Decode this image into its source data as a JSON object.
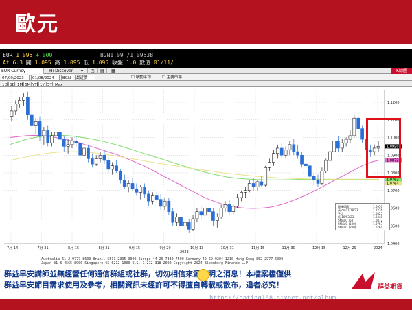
{
  "title": "歐元",
  "quote": {
    "ticker": "EUR",
    "last": "1.095",
    "change": "+.000",
    "bgn": "BGN1.09 /1.0953B",
    "line2_prefix": "At",
    "time": "6:3",
    "open_label": "開",
    "open": "1.095",
    "high_label": "高",
    "high": "1.095",
    "low_label": "低",
    "low": "1.095",
    "close_label": "收盤",
    "close": "1.0",
    "vol_label": "數值",
    "date": "01/11/"
  },
  "toolbar": {
    "security": "EUR Curncy",
    "discover": "Hi Discover",
    "right_btn": "K線圖"
  },
  "options": {
    "date_from": "07/09/2023",
    "date_to": "01/08/2024",
    "source": "BGN",
    "period_label": "最近價",
    "chk1": "移動平均",
    "chk2": "主要市場"
  },
  "chart_data": {
    "type": "candlestick",
    "yaxis_ticks": [
      "1.1200",
      "1.1100",
      "1.1000",
      "1.0900",
      "1.0800",
      "1.0700",
      "1.0600",
      "1.0500",
      "1.0400"
    ],
    "ylim": [
      1.04,
      1.127
    ],
    "xaxis_ticks": [
      "7月 14",
      "7月 31",
      "8月 15",
      "8月 31",
      "9月 15",
      "9月 29",
      "10月 13",
      "10月 31",
      "11月 15",
      "11月 30",
      "12月 15",
      "12月 29",
      "2024"
    ],
    "year_label": "2023",
    "last_price": "1.0950",
    "ma_labels": [
      "1.0872",
      "1.0763",
      "1.0764"
    ],
    "candles": [
      [
        1.112,
        1.118,
        1.109,
        1.115
      ],
      [
        1.115,
        1.121,
        1.113,
        1.119
      ],
      [
        1.119,
        1.123,
        1.117,
        1.121
      ],
      [
        1.121,
        1.125,
        1.118,
        1.123
      ],
      [
        1.123,
        1.126,
        1.11,
        1.113
      ],
      [
        1.113,
        1.116,
        1.105,
        1.107
      ],
      [
        1.107,
        1.111,
        1.102,
        1.109
      ],
      [
        1.109,
        1.112,
        1.098,
        1.101
      ],
      [
        1.101,
        1.106,
        1.096,
        1.104
      ],
      [
        1.104,
        1.107,
        1.095,
        1.097
      ],
      [
        1.097,
        1.103,
        1.095,
        1.101
      ],
      [
        1.101,
        1.106,
        1.098,
        1.103
      ],
      [
        1.103,
        1.104,
        1.096,
        1.099
      ],
      [
        1.099,
        1.101,
        1.092,
        1.095
      ],
      [
        1.095,
        1.099,
        1.091,
        1.096
      ],
      [
        1.096,
        1.1,
        1.094,
        1.098
      ],
      [
        1.098,
        1.101,
        1.095,
        1.097
      ],
      [
        1.097,
        1.098,
        1.088,
        1.09
      ],
      [
        1.09,
        1.096,
        1.088,
        1.094
      ],
      [
        1.094,
        1.096,
        1.086,
        1.088
      ],
      [
        1.088,
        1.091,
        1.083,
        1.085
      ],
      [
        1.085,
        1.09,
        1.084,
        1.088
      ],
      [
        1.088,
        1.092,
        1.086,
        1.09
      ],
      [
        1.09,
        1.093,
        1.085,
        1.087
      ],
      [
        1.087,
        1.089,
        1.08,
        1.082
      ],
      [
        1.082,
        1.086,
        1.079,
        1.084
      ],
      [
        1.084,
        1.087,
        1.08,
        1.081
      ],
      [
        1.081,
        1.082,
        1.074,
        1.076
      ],
      [
        1.076,
        1.079,
        1.071,
        1.072
      ],
      [
        1.072,
        1.076,
        1.069,
        1.074
      ],
      [
        1.074,
        1.077,
        1.07,
        1.071
      ],
      [
        1.071,
        1.074,
        1.067,
        1.069
      ],
      [
        1.069,
        1.073,
        1.065,
        1.072
      ],
      [
        1.072,
        1.074,
        1.066,
        1.068
      ],
      [
        1.068,
        1.07,
        1.061,
        1.064
      ],
      [
        1.064,
        1.069,
        1.062,
        1.067
      ],
      [
        1.067,
        1.07,
        1.063,
        1.065
      ],
      [
        1.065,
        1.068,
        1.059,
        1.061
      ],
      [
        1.061,
        1.066,
        1.059,
        1.064
      ],
      [
        1.064,
        1.066,
        1.056,
        1.058
      ],
      [
        1.058,
        1.06,
        1.05,
        1.052
      ],
      [
        1.052,
        1.057,
        1.05,
        1.055
      ],
      [
        1.055,
        1.058,
        1.048,
        1.05
      ],
      [
        1.05,
        1.054,
        1.047,
        1.052
      ],
      [
        1.052,
        1.054,
        1.046,
        1.048
      ],
      [
        1.048,
        1.056,
        1.047,
        1.054
      ],
      [
        1.054,
        1.06,
        1.052,
        1.058
      ],
      [
        1.058,
        1.061,
        1.053,
        1.056
      ],
      [
        1.056,
        1.062,
        1.054,
        1.06
      ],
      [
        1.06,
        1.063,
        1.056,
        1.058
      ],
      [
        1.058,
        1.06,
        1.05,
        1.053
      ],
      [
        1.053,
        1.057,
        1.049,
        1.055
      ],
      [
        1.055,
        1.062,
        1.054,
        1.06
      ],
      [
        1.06,
        1.064,
        1.058,
        1.062
      ],
      [
        1.062,
        1.065,
        1.056,
        1.058
      ],
      [
        1.058,
        1.062,
        1.056,
        1.061
      ],
      [
        1.061,
        1.068,
        1.06,
        1.066
      ],
      [
        1.066,
        1.07,
        1.064,
        1.069
      ],
      [
        1.069,
        1.072,
        1.066,
        1.07
      ],
      [
        1.07,
        1.076,
        1.069,
        1.074
      ],
      [
        1.074,
        1.077,
        1.07,
        1.072
      ],
      [
        1.072,
        1.076,
        1.07,
        1.075
      ],
      [
        1.075,
        1.078,
        1.072,
        1.073
      ],
      [
        1.073,
        1.084,
        1.072,
        1.083
      ],
      [
        1.083,
        1.088,
        1.081,
        1.086
      ],
      [
        1.086,
        1.093,
        1.084,
        1.091
      ],
      [
        1.091,
        1.096,
        1.088,
        1.094
      ],
      [
        1.094,
        1.097,
        1.088,
        1.09
      ],
      [
        1.09,
        1.095,
        1.088,
        1.093
      ],
      [
        1.093,
        1.098,
        1.09,
        1.096
      ],
      [
        1.096,
        1.099,
        1.09,
        1.092
      ],
      [
        1.092,
        1.096,
        1.088,
        1.09
      ],
      [
        1.09,
        1.092,
        1.083,
        1.085
      ],
      [
        1.085,
        1.088,
        1.082,
        1.084
      ],
      [
        1.084,
        1.086,
        1.076,
        1.078
      ],
      [
        1.078,
        1.08,
        1.073,
        1.076
      ],
      [
        1.076,
        1.079,
        1.072,
        1.074
      ],
      [
        1.074,
        1.083,
        1.073,
        1.081
      ],
      [
        1.081,
        1.088,
        1.08,
        1.087
      ],
      [
        1.087,
        1.093,
        1.086,
        1.092
      ],
      [
        1.092,
        1.099,
        1.09,
        1.098
      ],
      [
        1.098,
        1.101,
        1.092,
        1.094
      ],
      [
        1.094,
        1.099,
        1.092,
        1.097
      ],
      [
        1.097,
        1.1,
        1.095,
        1.099
      ],
      [
        1.099,
        1.104,
        1.097,
        1.101
      ],
      [
        1.101,
        1.113,
        1.1,
        1.111
      ],
      [
        1.111,
        1.114,
        1.103,
        1.105
      ],
      [
        1.105,
        1.107,
        1.097,
        1.099
      ],
      [
        1.099,
        1.101,
        1.091,
        1.093
      ],
      [
        1.093,
        1.096,
        1.089,
        1.092
      ],
      [
        1.092,
        1.096,
        1.09,
        1.094
      ],
      [
        1.094,
        1.098,
        1.092,
        1.095
      ]
    ],
    "ma_series": [
      {
        "name": "SMAVG (50)",
        "color": "#e066c8",
        "values": [
          1.1,
          1.1005,
          1.101,
          1.1012,
          1.101,
          1.1005,
          1.0995,
          1.0985,
          1.0975,
          1.096,
          1.0945,
          1.093,
          1.0915,
          1.09,
          1.088,
          1.086,
          1.084,
          1.0815,
          1.079,
          1.0765,
          1.074,
          1.0715,
          1.069,
          1.0665,
          1.0645,
          1.0628,
          1.0615,
          1.0605,
          1.06,
          1.0598,
          1.06,
          1.0605,
          1.0615,
          1.063,
          1.0648,
          1.0668,
          1.069,
          1.0715,
          1.074,
          1.0765,
          1.079,
          1.0815,
          1.084,
          1.086,
          1.0872
        ]
      },
      {
        "name": "SMAVG (100)",
        "color": "#7ddc6a",
        "values": [
          1.096,
          1.0975,
          1.099,
          1.1,
          1.1008,
          1.1012,
          1.1012,
          1.101,
          1.1005,
          1.0998,
          1.099,
          1.098,
          1.0968,
          1.0955,
          1.094,
          1.0925,
          1.091,
          1.0895,
          1.088,
          1.0865,
          1.085,
          1.0835,
          1.082,
          1.0807,
          1.0795,
          1.0785,
          1.0776,
          1.077,
          1.0766,
          1.0763,
          1.0761,
          1.076,
          1.076,
          1.0761,
          1.0762,
          1.0763,
          1.0763,
          1.0763,
          1.0763,
          1.0763,
          1.0763,
          1.0763,
          1.0763,
          1.0763,
          1.0763
        ]
      },
      {
        "name": "SMAVG (200)",
        "color": "#e9e38a",
        "values": [
          1.087,
          1.088,
          1.089,
          1.09,
          1.0908,
          1.0914,
          1.0918,
          1.092,
          1.092,
          1.0918,
          1.0914,
          1.0908,
          1.09,
          1.0892,
          1.0884,
          1.0876,
          1.0868,
          1.086,
          1.0852,
          1.0845,
          1.0838,
          1.083,
          1.0823,
          1.0816,
          1.081,
          1.0803,
          1.0797,
          1.0792,
          1.0787,
          1.0782,
          1.0778,
          1.0775,
          1.0772,
          1.077,
          1.0768,
          1.0766,
          1.0765,
          1.0764,
          1.0764,
          1.0764,
          1.0764,
          1.0764,
          1.0764,
          1.0764,
          1.0764
        ]
      }
    ]
  },
  "legend": {
    "rows": [
      {
        "label": "最後價格",
        "value": "1.0950"
      },
      {
        "label": "高 on 07/18/23",
        "value": "1.1276"
      },
      {
        "label": "平均",
        "value": "1.0825"
      },
      {
        "label": "低 10/03/23",
        "value": "1.0448"
      },
      {
        "label": "SMAVG (50)",
        "value": "1.0872"
      },
      {
        "label": "SMAVG (100)",
        "value": "1.0763"
      },
      {
        "label": "SMAVG (200)",
        "value": "1.0764"
      }
    ]
  },
  "footer": {
    "line1": "Australia 61 2 9777 8600 Brazil 5511 2395 9000 Europe 44 20 7330 7500 Germany 49 69 9204 1210 Hong Kong 852 2977 6000",
    "line2": "Japan 81 3 4565 8900        Singapore 65 6212 1000       U.S. 1 212 318 2000        Copyright 2024 Bloomberg Finance L.P.",
    "line3": "SN 126661 HKT GMT+8:00 G652-2145-171 09-Jan-2024 06:34:30"
  },
  "disclaimer": {
    "line1": "群益早安講師並無經營任何通信群組或社群，切勿相信來源不明之消息！本檔案檔僅供",
    "line2": "群益早安節目需求使用及參考，相關資訊未經許可不得擅自轉載或散布，違者必究！"
  },
  "watermark": {
    "text": "群 益 期 貨       宜 庭 EATING",
    "url": "https://eating168.pixnet.net/album"
  },
  "brand": {
    "name": "群益期貨",
    "en": "CAPITAL"
  },
  "colors": {
    "accent": "#b3121e",
    "candle_up": "#ffffff",
    "candle_down": "#2b6fd6",
    "highlight": "#e0101a"
  }
}
